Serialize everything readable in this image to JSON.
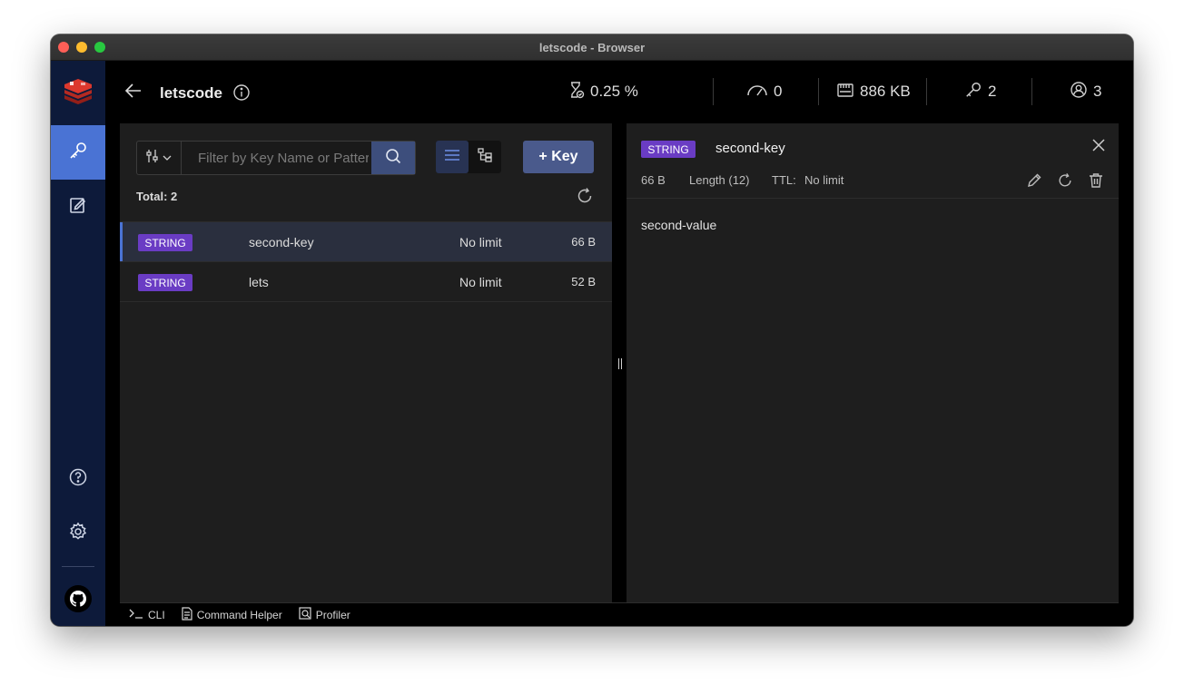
{
  "window": {
    "title": "letscode - Browser"
  },
  "header": {
    "db_name": "letscode",
    "stats": {
      "cpu": "0.25 %",
      "ops": "0",
      "memory": "886 KB",
      "keys": "2",
      "clients": "3"
    }
  },
  "toolbar": {
    "search_placeholder": "Filter by Key Name or Pattern",
    "add_key_label": "+ Key"
  },
  "list": {
    "total_label": "Total: 2",
    "keys": [
      {
        "type": "STRING",
        "name": "second-key",
        "ttl": "No limit",
        "size": "66 B",
        "selected": true
      },
      {
        "type": "STRING",
        "name": "lets",
        "ttl": "No limit",
        "size": "52 B",
        "selected": false
      }
    ]
  },
  "detail": {
    "type": "STRING",
    "name": "second-key",
    "size": "66 B",
    "length": "Length (12)",
    "ttl_label": "TTL:",
    "ttl_value": "No limit",
    "value": "second-value"
  },
  "bottom": {
    "cli": "CLI",
    "command_helper": "Command Helper",
    "profiler": "Profiler"
  },
  "colors": {
    "accent": "#4a73d4",
    "badge_string": "#6a3cc4",
    "sidebar": "#0d1a3a",
    "brand": "#dc382d"
  }
}
